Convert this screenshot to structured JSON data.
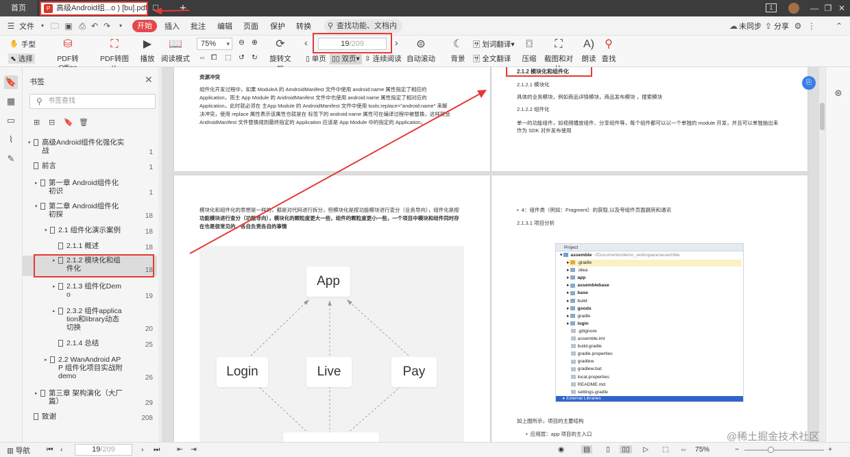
{
  "tabs": {
    "home": "首页",
    "document": "高级Android组...o ) [bu].pdf"
  },
  "menu": {
    "file": "文件",
    "items": [
      "开始",
      "插入",
      "批注",
      "编辑",
      "页面",
      "保护",
      "转换"
    ],
    "search_placeholder": "查找功能、文档内容",
    "sync": "未同步",
    "share": "分享"
  },
  "toolbar": {
    "hand": "手型",
    "select": "选择",
    "pdf_to_office": "PDF转Office",
    "pdf_to_image": "PDF转图片",
    "play": "播放",
    "read_mode": "阅读模式",
    "zoom": "75%",
    "rotate": "旋转文档",
    "single_page": "单页",
    "double_page": "双页",
    "continuous": "连续阅读",
    "page_current": "19",
    "page_total": "/209",
    "auto_scroll": "自动滚动",
    "background": "背景",
    "word_translate": "划词翻译",
    "full_translate": "全文翻译",
    "compress": "压缩",
    "screenshot_compare": "截图和对比",
    "read_aloud": "朗读",
    "find": "查找"
  },
  "bookmarks": {
    "title": "书签",
    "search_placeholder": "书签查找",
    "items": [
      {
        "label": "高级Android组件化强化实",
        "label2": "战",
        "page": "1"
      },
      {
        "label": "前言",
        "page": "1"
      },
      {
        "label": "第一章 Android组件化",
        "label2": "初识",
        "page": "1"
      },
      {
        "label": "第二章 Android组件化",
        "label2": "初探",
        "page": "18"
      },
      {
        "label": "2.1 组件化演示案例",
        "page": "18"
      },
      {
        "label": "2.1.1 概述",
        "page": "18"
      },
      {
        "label": "2.1.2 模块化和组",
        "label2": "件化",
        "page": "18"
      },
      {
        "label": "2.1.3 组件化Dem",
        "label2": "o",
        "page": "19"
      },
      {
        "label": "2.3.2 组件applica",
        "label2": "tion和library动态",
        "label3": "切换",
        "page": "20"
      },
      {
        "label": "2.1.4 总结",
        "page": "25"
      },
      {
        "label": "2.2 WanAndroid AP",
        "label2": "P 组件化项目实战附",
        "label3": "demo",
        "page": "26"
      },
      {
        "label": "第三章 架构演化（大厂",
        "label2": "篇）",
        "page": "29"
      },
      {
        "label": "致谢",
        "page": "208"
      }
    ]
  },
  "page_left_top": {
    "heading": "资源冲突",
    "lines": [
      "组件化开发过程中，如果 ModuleA 的 AmdroidManifest 文件中使用 android:name 属性指定了相应的",
      "Application，而主 App Module 的 AndroidManifest 文件中也使用 android:name 属性指定了相对应的",
      "Application，此时就必须在 主App Module 的 AndroidManifest 文件中使用 tools:replace=\"android:name\" 来解",
      "决冲突，使用 replace 属性表示该属性也就是在 标签下的 android:name 属性可在编译过程中被替换，这样就会",
      "AndroidManifest 文件替换规则最终指定的 Application 应该是 App Module 中的指定的 Application。"
    ]
  },
  "page_right_top": {
    "heading": "2.1.2 模块化和组件化",
    "sub1": "2.1.2.1 模块化",
    "text1": "具体的业务模块，例如商品详情模块，商品发布模块 ，搜索模块",
    "sub2": "2.1.2.2 组件化",
    "text2a": "单一的功能组件，如视频播放组件、分享组件等，每个组件都可以以一个单独的 module 开发，并且可以单独抽出来",
    "text2b": "作为 SDK 对外发布使用"
  },
  "page_left_bottom": {
    "line1": "模块化和组件化的思想是一样的，都是对代码进行拆分，但模块化是按功能模块进行查分（业务导向），组件化是按",
    "line2": "功能模块进行查分（功能导向），模块化的颗粒度更大一些，组件的颗粒度更小一些，一个项目中模块和组件同时存",
    "line3": "在也是很常见的，各自负责各自的事情",
    "nodes": [
      "App",
      "Login",
      "Live",
      "Pay"
    ]
  },
  "page_right_bottom": {
    "bullet": "4：组件类（例如：Fragment）的获取,以及夸组件页面跳转和通讯",
    "sub": "2.1.3.1 项目分析",
    "project_header": "Project",
    "project_root": "assemble",
    "project_path": "~/Documents/demo_workspace/assemble",
    "project_items": [
      ".gradle",
      ".idea",
      "app",
      "assemblebase",
      "base",
      "build",
      "goods",
      "gradle",
      "login",
      ".gitignore",
      "assemble.iml",
      "build.gradle",
      "gradle.properties",
      "gradlew",
      "gradlew.bat",
      "local.properties",
      "README.md",
      "settings.gradle"
    ],
    "project_footer": "External Libraries",
    "caption": "如上图所示，项目的主要结构",
    "bullet2": "应用层：app 项目的主入口"
  },
  "statusbar": {
    "nav": "导航",
    "page_current": "19",
    "page_total": "/209",
    "zoom": "75%"
  },
  "watermark": "@稀土掘金技术社区",
  "colors": {
    "accent": "#e5474b",
    "annotation_red": "#e53935",
    "project_selection": "#2f65ca"
  }
}
